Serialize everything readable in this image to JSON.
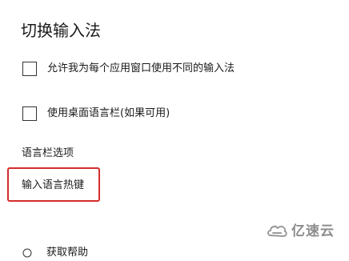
{
  "page": {
    "title": "切换输入法"
  },
  "options": {
    "per_app_input": {
      "label": "允许我为每个应用窗口使用不同的输入法",
      "checked": false
    },
    "desktop_language_bar": {
      "label": "使用桌面语言栏(如果可用)",
      "checked": false
    }
  },
  "language_bar": {
    "section_label": "语言栏选项",
    "hotkeys_link": "输入语言热键"
  },
  "help": {
    "label": "获取帮助",
    "icon": "help-icon"
  },
  "watermark": {
    "text": "亿速云",
    "icon": "cloud-logo-icon"
  },
  "colors": {
    "highlight": "#d62c2c",
    "watermark": "#8c8c8c"
  }
}
